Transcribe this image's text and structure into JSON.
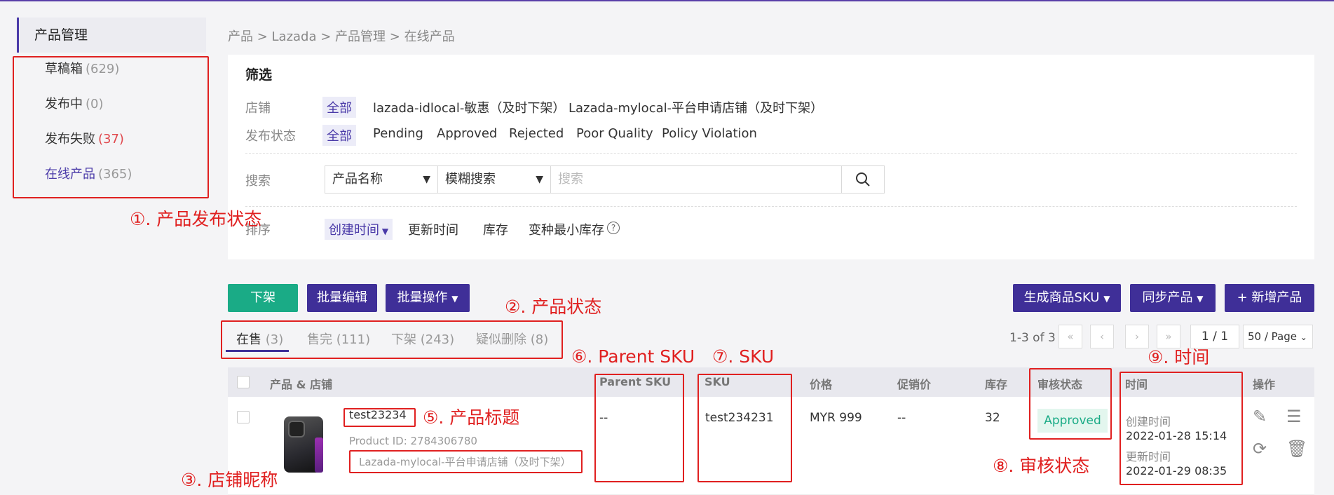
{
  "breadcrumb": "产品 > Lazada > 产品管理 > 在线产品",
  "sidebar": {
    "header": "产品管理",
    "items": [
      {
        "label": "草稿箱",
        "count": "(629)"
      },
      {
        "label": "发布中",
        "count": "(0)"
      },
      {
        "label": "发布失败",
        "count": "(37)"
      },
      {
        "label": "在线产品",
        "count": "(365)"
      }
    ]
  },
  "filter": {
    "title": "筛选",
    "shop_label": "店铺",
    "shop_options": [
      "全部",
      "lazada-idlocal-敏惠（及时下架）",
      "Lazada-mylocal-平台申请店铺（及时下架）"
    ],
    "status_label": "发布状态",
    "status_options": [
      "全部",
      "Pending",
      "Approved",
      "Rejected",
      "Poor Quality",
      "Policy Violation"
    ],
    "search_label": "搜索",
    "search_field": "产品名称",
    "search_mode": "模糊搜索",
    "search_placeholder": "搜索",
    "sort_label": "排序",
    "sort_options": [
      "创建时间",
      "更新时间",
      "库存",
      "变种最小库存"
    ]
  },
  "toolbar": {
    "delist": "下架",
    "batch_edit": "批量编辑",
    "batch_ops": "批量操作",
    "gen_sku": "生成商品SKU",
    "sync": "同步产品",
    "add": "+ 新增产品"
  },
  "tabs": [
    {
      "label": "在售",
      "count": "(3)"
    },
    {
      "label": "售完",
      "count": "(111)"
    },
    {
      "label": "下架",
      "count": "(243)"
    },
    {
      "label": "疑似删除",
      "count": "(8)"
    }
  ],
  "pager": {
    "range": "1-3 of 3",
    "page": "1 / 1",
    "per_page": "50 / Page"
  },
  "table": {
    "headers": [
      "产品 & 店铺",
      "Parent SKU",
      "SKU",
      "价格",
      "促销价",
      "库存",
      "审核状态",
      "时间",
      "操作"
    ],
    "row": {
      "title": "test23234",
      "product_id": "Product ID: 2784306780",
      "shop": "Lazada-mylocal-平台申请店铺（及时下架）",
      "parent_sku": "--",
      "sku": "test234231",
      "price": "MYR  999",
      "promo_price": "--",
      "stock": "32",
      "status": "Approved",
      "created_label": "创建时间",
      "created": "2022-01-28 15:14",
      "updated_label": "更新时间",
      "updated": "2022-01-29 08:35"
    }
  },
  "annotations": {
    "a1": "①. 产品发布状态",
    "a2": "②. 产品状态",
    "a3": "③. 店铺昵称",
    "a5": "⑤. 产品标题",
    "a6": "⑥. Parent SKU",
    "a7": "⑦. SKU",
    "a8": "⑧. 审核状态",
    "a9": "⑨. 时间"
  }
}
